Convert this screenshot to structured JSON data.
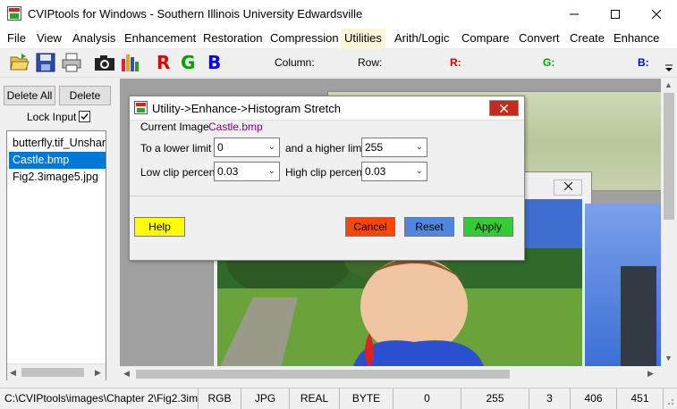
{
  "window": {
    "title": "CVIPtools for Windows - Southern Illinois University Edwardsville",
    "minimize": "—",
    "maximize": "☐",
    "close": "✕"
  },
  "menu": {
    "items": [
      "File",
      "View",
      "Analysis",
      "Enhancement",
      "Restoration",
      "Compression",
      "Utilities",
      "Arith/Logic",
      "Compare",
      "Convert",
      "Create",
      "Enhance"
    ],
    "active": "Utilities"
  },
  "toolbar": {
    "icons": [
      "open-folder-icon",
      "save-icon",
      "print-icon",
      "camera-icon",
      "histogram-icon"
    ],
    "letters": {
      "r": "R",
      "g": "G",
      "b": "B"
    },
    "labels": {
      "column": "Column:",
      "row": "Row:",
      "r": "R:",
      "g": "G:",
      "b": "B:"
    },
    "colors": {
      "r": "#e00000",
      "g": "#00a000",
      "b": "#0000e0"
    }
  },
  "left_panel": {
    "delete_all": "Delete All",
    "delete": "Delete",
    "lock_input": "Lock Input",
    "lock_checked": true,
    "files": [
      "butterfly.tif_Unsharp",
      "Castle.bmp",
      "Fig2.3image5.jpg"
    ],
    "selected_index": 1
  },
  "dialog": {
    "title": "Utility->Enhance->Histogram Stretch",
    "current_image_label": "Current Image",
    "current_image_value": "Castle.bmp",
    "lower_limit_label": "To a lower limit",
    "lower_limit_value": "0",
    "higher_limit_label": "and a higher limit",
    "higher_limit_value": "255",
    "low_clip_label": "Low clip percent",
    "low_clip_value": "0.03",
    "high_clip_label": "High clip percent",
    "high_clip_value": "0.03",
    "help": "Help",
    "cancel": "Cancel",
    "reset": "Reset",
    "apply": "Apply",
    "colors": {
      "help": "#ffff00",
      "cancel": "#ff4500",
      "reset": "#4f86e0",
      "apply": "#32cd32",
      "value": "#800080"
    }
  },
  "status_bar": {
    "path": "C:\\CVIPtools\\images\\Chapter 2\\Fig2.3im",
    "color_space": "RGB",
    "format": "JPG",
    "data_format": "REAL",
    "data_type": "BYTE",
    "val1": "0",
    "val2": "255",
    "bands": "3",
    "height": "406",
    "width": "451"
  }
}
